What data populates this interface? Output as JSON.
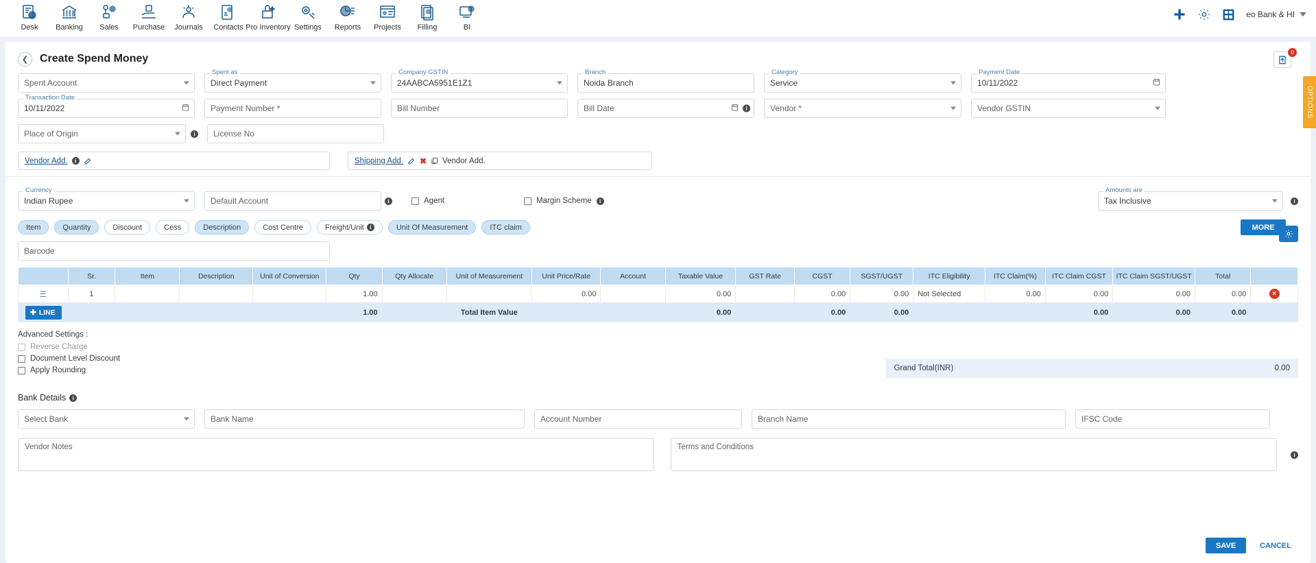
{
  "nav": {
    "items": [
      {
        "label": "Desk",
        "icon": "desk-icon"
      },
      {
        "label": "Banking",
        "icon": "bank-icon"
      },
      {
        "label": "Sales",
        "icon": "sales-icon"
      },
      {
        "label": "Purchase",
        "icon": "purchase-icon"
      },
      {
        "label": "Journals",
        "icon": "journals-icon"
      },
      {
        "label": "Contacts",
        "icon": "contacts-icon"
      },
      {
        "label": "Pro Inventory",
        "icon": "inventory-icon"
      },
      {
        "label": "Settings",
        "icon": "settings-icon"
      },
      {
        "label": "Reports",
        "icon": "reports-icon"
      },
      {
        "label": "Projects",
        "icon": "projects-icon"
      },
      {
        "label": "Filling",
        "icon": "filling-icon"
      },
      {
        "label": "BI",
        "icon": "bi-icon"
      }
    ],
    "add_icon": "plus-icon",
    "gear_icon": "gear-icon",
    "calculator_icon": "calculator-icon",
    "user_label": "eo Bank & HI"
  },
  "header": {
    "title": "Create Spend Money",
    "back_icon": "chevron-left-icon",
    "upload_icon": "upload-icon",
    "upload_badge": "0",
    "options_tab": "OPTIONS"
  },
  "form": {
    "spent_account": {
      "label": "",
      "placeholder": "Spent Account",
      "value": ""
    },
    "spent_as": {
      "label": "Spent as",
      "value": "Direct Payment"
    },
    "company_gstin": {
      "label": "Company GSTIN",
      "value": "24AABCA5951E1Z1"
    },
    "branch": {
      "label": "Branch",
      "value": "Noida Branch"
    },
    "category": {
      "label": "Category",
      "value": "Service"
    },
    "payment_date": {
      "label": "Payment Date",
      "value": "10/11/2022"
    },
    "transaction_date": {
      "label": "Transaction Date",
      "value": "10/11/2022"
    },
    "payment_number": {
      "placeholder": "Payment Number *",
      "value": ""
    },
    "bill_number": {
      "placeholder": "Bill Number",
      "value": ""
    },
    "bill_date": {
      "placeholder": "Bill Date",
      "value": ""
    },
    "vendor": {
      "placeholder": "Vendor *",
      "value": ""
    },
    "vendor_gstin": {
      "placeholder": "Vendor GSTIN",
      "value": ""
    },
    "place_of_origin": {
      "placeholder": "Place of Origin",
      "value": ""
    },
    "license_no": {
      "placeholder": "License No",
      "value": ""
    },
    "vendor_address_link": "Vendor Add.",
    "shipping_address_link": "Shipping Add.",
    "copy_vendor_add_label": "Vendor Add.",
    "currency": {
      "label": "Currency",
      "value": "Indian Rupee"
    },
    "default_account": {
      "placeholder": "Default Account",
      "value": ""
    },
    "agent_checkbox": "Agent",
    "margin_scheme_checkbox": "Margin Scheme",
    "amounts_are": {
      "label": "Amounts are",
      "value": "Tax Inclusive"
    }
  },
  "chips": [
    {
      "label": "Item",
      "active": true,
      "info": false
    },
    {
      "label": "Quantity",
      "active": true,
      "info": false
    },
    {
      "label": "Discount",
      "active": false,
      "info": false
    },
    {
      "label": "Cess",
      "active": false,
      "info": false
    },
    {
      "label": "Description",
      "active": true,
      "info": false
    },
    {
      "label": "Cost Centre",
      "active": false,
      "info": false
    },
    {
      "label": "Freight/Unit",
      "active": false,
      "info": true
    },
    {
      "label": "Unit Of Measurement",
      "active": true,
      "info": false
    },
    {
      "label": "ITC claim",
      "active": true,
      "info": false
    }
  ],
  "more_button": "MORE",
  "barcode": {
    "placeholder": "Barcode",
    "value": ""
  },
  "table": {
    "columns": [
      "",
      "Sr.",
      "Item",
      "Description",
      "Unit of Conversion",
      "Qty",
      "Qty Allocate",
      "Unit of Measurement",
      "Unit Price/Rate",
      "Account",
      "Taxable Value",
      "GST Rate",
      "CGST",
      "SGST/UGST",
      "ITC Eligibility",
      "ITC Claim(%)",
      "ITC Claim CGST",
      "ITC Claim SGST/UGST",
      "Total",
      ""
    ],
    "rows": [
      {
        "handle": "drag-handle-icon",
        "sr": "1",
        "item": "",
        "description": "",
        "unit_of_conversion": "",
        "qty": "1.00",
        "qty_allocate": "",
        "unit_of_measurement": "",
        "unit_price_rate": "0.00",
        "account": "",
        "taxable_value": "0.00",
        "gst_rate": "",
        "cgst": "0.00",
        "sgst_ugst": "0.00",
        "itc_eligibility": "Not Selected",
        "itc_claim_pct": "0.00",
        "itc_claim_cgst": "0.00",
        "itc_claim_sgst_ugst": "0.00",
        "total": "0.00",
        "delete": "×"
      }
    ],
    "footer": {
      "line_button": "LINE",
      "qty_total": "1.00",
      "total_item_value_label": "Total Item Value",
      "taxable_value": "0.00",
      "cgst": "0.00",
      "sgst_ugst": "0.00",
      "itc_claim_cgst": "0.00",
      "itc_claim_sgst_ugst": "0.00",
      "total": "0.00"
    }
  },
  "advanced": {
    "title": "Advanced Settings :",
    "options": [
      {
        "label": "Reverse Charge",
        "disabled": true
      },
      {
        "label": "Document Level Discount",
        "disabled": false
      },
      {
        "label": "Apply Rounding",
        "disabled": false
      }
    ]
  },
  "grand_total": {
    "label": "Grand Total(INR)",
    "value": "0.00"
  },
  "bank": {
    "title": "Bank Details",
    "select_bank": {
      "placeholder": "Select Bank",
      "value": ""
    },
    "bank_name": {
      "placeholder": "Bank Name",
      "value": ""
    },
    "account_number": {
      "placeholder": "Account Number",
      "value": ""
    },
    "branch_name": {
      "placeholder": "Branch Name",
      "value": ""
    },
    "ifsc_code": {
      "placeholder": "IFSC Code",
      "value": ""
    }
  },
  "notes": {
    "vendor_notes": {
      "placeholder": "Vendor Notes",
      "value": ""
    },
    "terms": {
      "placeholder": "Terms and Conditions",
      "value": ""
    }
  },
  "footer": {
    "save": "SAVE",
    "cancel": "CANCEL"
  },
  "colors": {
    "accent": "#1a77c5",
    "header_bg": "#bfdcf2",
    "totals_bg": "#ddebf8",
    "options_tab": "#f6a623",
    "danger": "#d1392b"
  }
}
